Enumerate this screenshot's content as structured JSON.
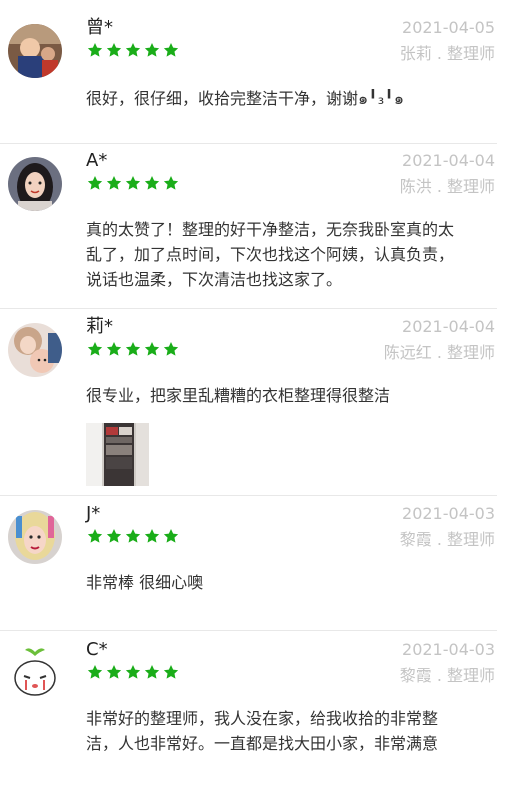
{
  "colors": {
    "star": "#1aad19",
    "date": "#c4c4c4",
    "divider": "#e8e8e8"
  },
  "reviews": [
    {
      "name": "曾*",
      "date": "2021-04-05",
      "staff": "张莉 . 整理师",
      "rating": 5,
      "text": "很好，很仔细，收拾完整洁干净，谢谢๑╹₃╹๑"
    },
    {
      "name": "A*",
      "date": "2021-04-04",
      "staff": "陈洪 . 整理师",
      "rating": 5,
      "text": "真的太赞了！整理的好干净整洁，无奈我卧室真的太乱了，加了点时间，下次也找这个阿姨，认真负责，说话也温柔，下次清洁也找这家了。"
    },
    {
      "name": "莉*",
      "date": "2021-04-04",
      "staff": "陈远红 . 整理师",
      "rating": 5,
      "text": "很专业，把家里乱糟糟的衣柜整理得很整洁",
      "has_photo": true
    },
    {
      "name": "J*",
      "date": "2021-04-03",
      "staff": "黎霞 . 整理师",
      "rating": 5,
      "text": "非常棒 很细心噢"
    },
    {
      "name": "C*",
      "date": "2021-04-03",
      "staff": "黎霞 . 整理师",
      "rating": 5,
      "text": "非常好的整理师，我人没在家，给我收拾的非常整洁，人也非常好。一直都是找大田小家，非常满意"
    }
  ]
}
